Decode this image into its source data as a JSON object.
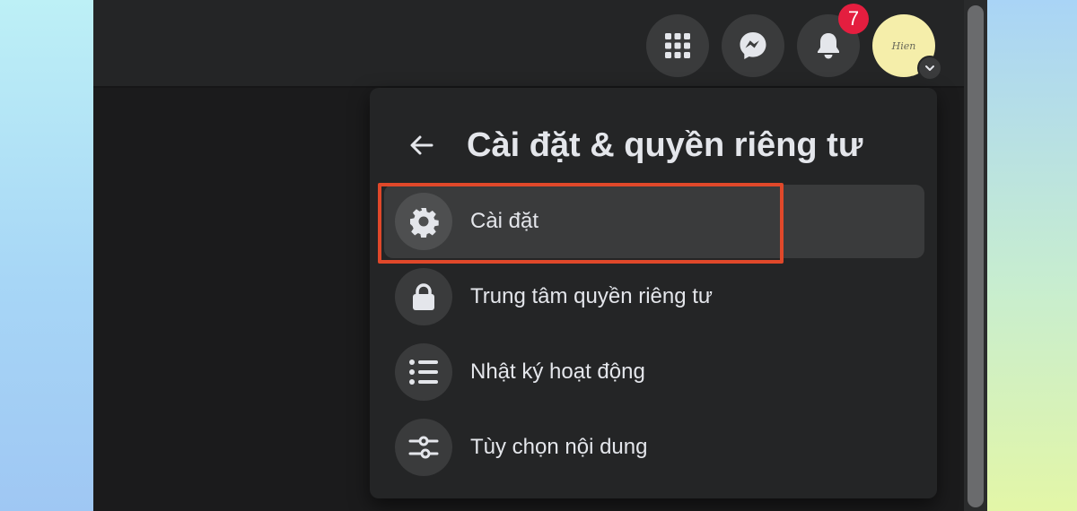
{
  "header": {
    "notification_count": "7",
    "icons": [
      "menu-grid-icon",
      "messenger-icon",
      "bell-icon"
    ],
    "avatar_text": "Hien"
  },
  "panel": {
    "title": "Cài đặt & quyền riêng tư",
    "items": [
      {
        "label": "Cài đặt",
        "icon": "gear-icon",
        "selected": true
      },
      {
        "label": "Trung tâm quyền riêng tư",
        "icon": "lock-icon"
      },
      {
        "label": "Nhật ký hoạt động",
        "icon": "list-icon"
      },
      {
        "label": "Tùy chọn nội dung",
        "icon": "sliders-icon"
      }
    ]
  },
  "colors": {
    "highlight": "#e0482a",
    "badge": "#e41e3f",
    "panel_bg": "#242526",
    "text": "#e4e6eb"
  }
}
